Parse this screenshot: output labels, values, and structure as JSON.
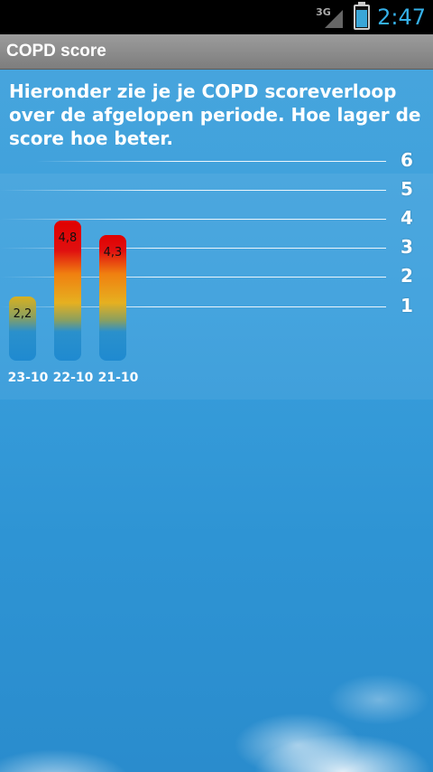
{
  "status": {
    "clock": "2:47",
    "network": "3G"
  },
  "app": {
    "title": "COPD score"
  },
  "intro": "Hieronder zie je je COPD scoreverloop over de afgelopen periode. Hoe lager de score hoe beter.",
  "chart_data": {
    "type": "bar",
    "categories": [
      "23-10",
      "22-10",
      "21-10"
    ],
    "values": [
      2.2,
      4.8,
      4.3
    ],
    "value_labels": [
      "2,2",
      "4,8",
      "4,3"
    ],
    "ylim": [
      0,
      6
    ],
    "yticks": [
      "1",
      "2",
      "3",
      "4",
      "5",
      "6"
    ],
    "grid": true
  }
}
